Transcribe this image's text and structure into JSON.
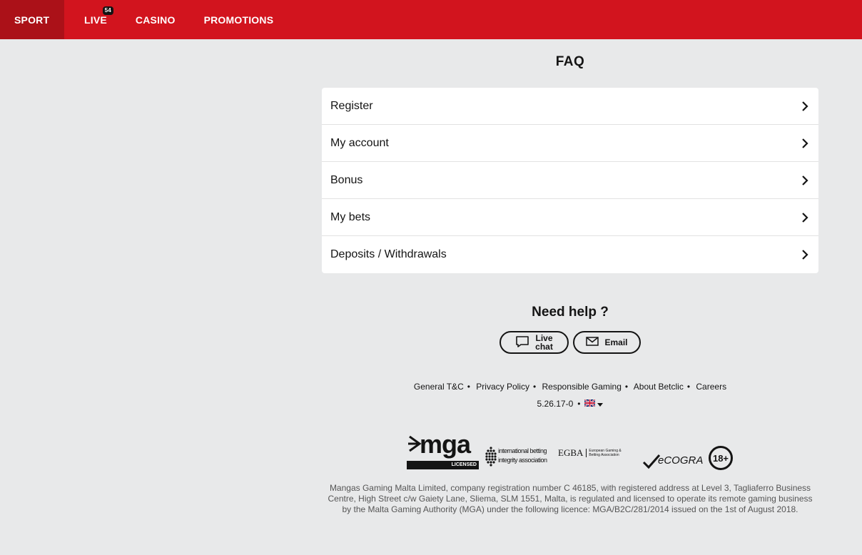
{
  "nav": {
    "items": [
      {
        "label": "SPORT"
      },
      {
        "label": "LIVE",
        "badge": "54"
      },
      {
        "label": "CASINO"
      },
      {
        "label": "PROMOTIONS"
      }
    ]
  },
  "faq": {
    "title": "FAQ",
    "items": [
      {
        "label": "Register"
      },
      {
        "label": "My account"
      },
      {
        "label": "Bonus"
      },
      {
        "label": "My bets"
      },
      {
        "label": "Deposits / Withdrawals"
      }
    ]
  },
  "help": {
    "title": "Need help ?",
    "chat_line1": "Live",
    "chat_line2": "chat",
    "email_label": "Email"
  },
  "footer": {
    "links": [
      "General T&C",
      "Privacy Policy",
      "Responsible Gaming",
      "About Betclic",
      "Careers"
    ],
    "version": "5.26.17-0",
    "language_icon": "uk-flag-icon"
  },
  "logos": {
    "mga": "mga",
    "mga_sub": "LICENSED",
    "ibia_line1": "international betting",
    "ibia_line2": "integrity association",
    "egba": "EGBA",
    "egba_sub": "European Gaming & Betting Association",
    "ecogra": "eCOGRA",
    "age": "18+"
  },
  "legal": "Mangas Gaming Malta Limited, company registration number C 46185, with registered address at Level 3, Tagliaferro Business Centre, High Street c/w Gaiety Lane, Sliema, SLM 1551, Malta, is regulated and licensed to operate its remote gaming business by the Malta Gaming Authority (MGA) under the following licence: MGA/B2C/281/2014 issued on the 1st of August 2018.",
  "colors": {
    "brand": "#d2141e",
    "brand_dark": "#ab1118",
    "background": "#e8e9ea"
  }
}
